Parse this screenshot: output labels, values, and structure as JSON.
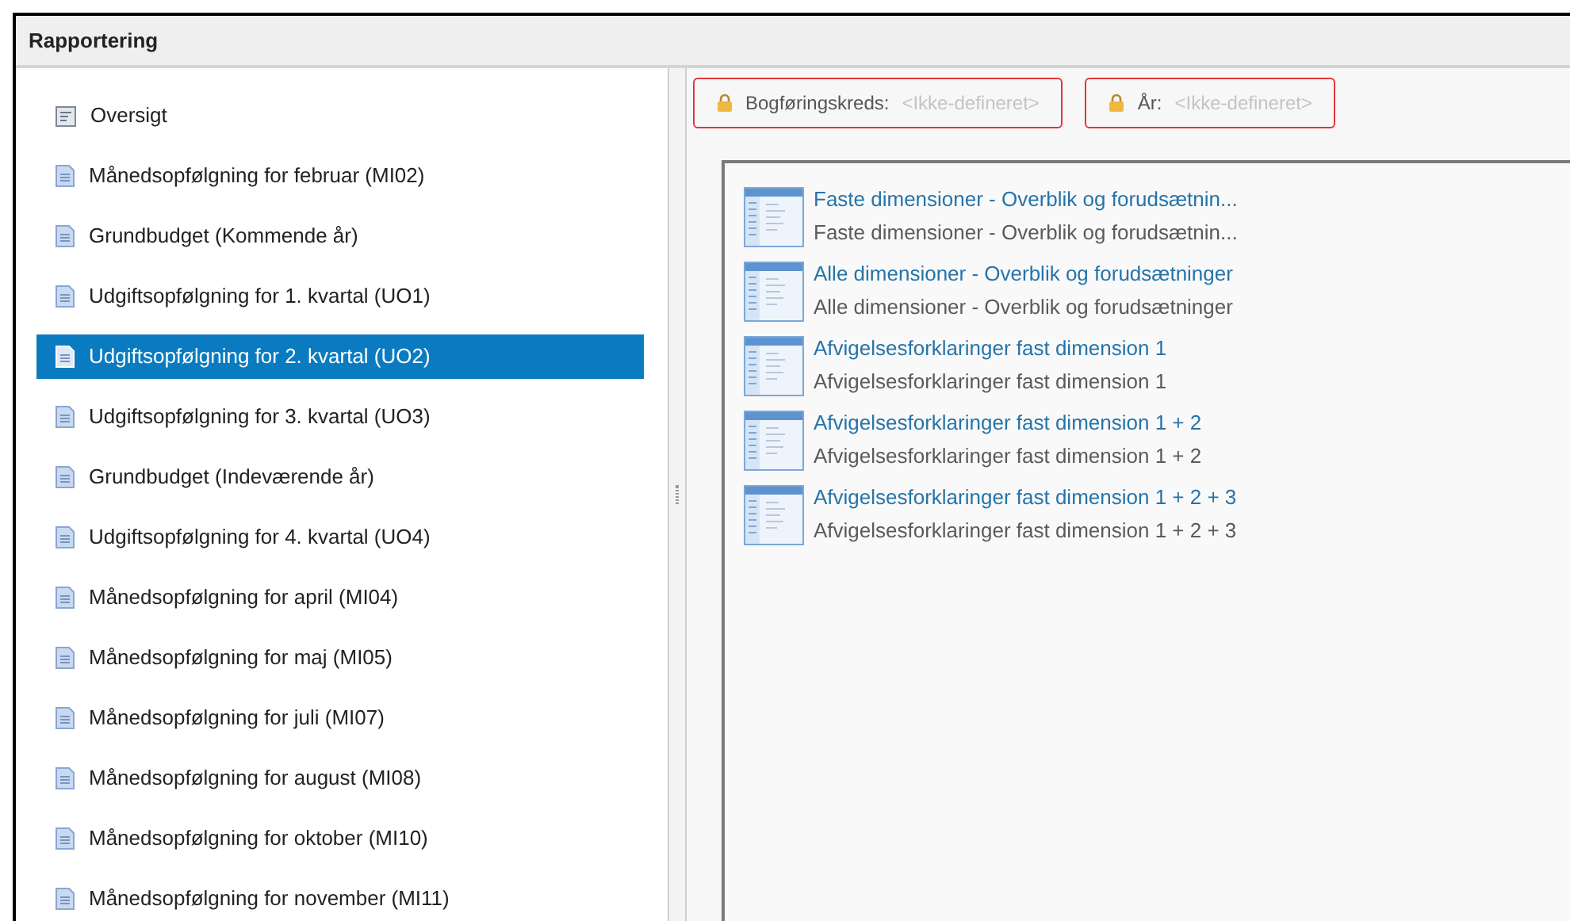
{
  "panel": {
    "title": "Rapportering"
  },
  "sidebar": {
    "items": [
      {
        "label": "Oversigt",
        "kind": "overview",
        "selected": false
      },
      {
        "label": "Månedsopfølgning for februar (MI02)",
        "kind": "report",
        "selected": false
      },
      {
        "label": "Grundbudget (Kommende år)",
        "kind": "report",
        "selected": false
      },
      {
        "label": "Udgiftsopfølgning for 1. kvartal (UO1)",
        "kind": "report",
        "selected": false
      },
      {
        "label": "Udgiftsopfølgning for 2. kvartal (UO2)",
        "kind": "report",
        "selected": true
      },
      {
        "label": "Udgiftsopfølgning for 3. kvartal (UO3)",
        "kind": "report",
        "selected": false
      },
      {
        "label": "Grundbudget (Indeværende år)",
        "kind": "report",
        "selected": false
      },
      {
        "label": "Udgiftsopfølgning for 4. kvartal (UO4)",
        "kind": "report",
        "selected": false
      },
      {
        "label": "Månedsopfølgning for april (MI04)",
        "kind": "report",
        "selected": false
      },
      {
        "label": "Månedsopfølgning for maj (MI05)",
        "kind": "report",
        "selected": false
      },
      {
        "label": "Månedsopfølgning for juli (MI07)",
        "kind": "report",
        "selected": false
      },
      {
        "label": "Månedsopfølgning for august (MI08)",
        "kind": "report",
        "selected": false
      },
      {
        "label": "Månedsopfølgning for oktober (MI10)",
        "kind": "report",
        "selected": false
      },
      {
        "label": "Månedsopfølgning for november (MI11)",
        "kind": "report",
        "selected": false
      }
    ]
  },
  "filters": [
    {
      "label": "Bogføringskreds:",
      "placeholder": "<Ikke-defineret>",
      "locked": true
    },
    {
      "label": "År:",
      "placeholder": "<Ikke-defineret>",
      "locked": true
    }
  ],
  "reports": [
    {
      "title": "Faste dimensioner - Overblik og forudsætnin...",
      "description": "Faste dimensioner - Overblik og forudsætnin..."
    },
    {
      "title": "Alle dimensioner - Overblik og forudsætninger",
      "description": "Alle dimensioner - Overblik og forudsætninger"
    },
    {
      "title": "Afvigelsesforklaringer fast dimension 1",
      "description": "Afvigelsesforklaringer fast dimension 1"
    },
    {
      "title": "Afvigelsesforklaringer fast dimension 1 + 2",
      "description": "Afvigelsesforklaringer fast dimension 1 + 2"
    },
    {
      "title": "Afvigelsesforklaringer fast dimension 1 + 2 + 3",
      "description": "Afvigelsesforklaringer fast dimension 1 + 2 + 3"
    }
  ]
}
